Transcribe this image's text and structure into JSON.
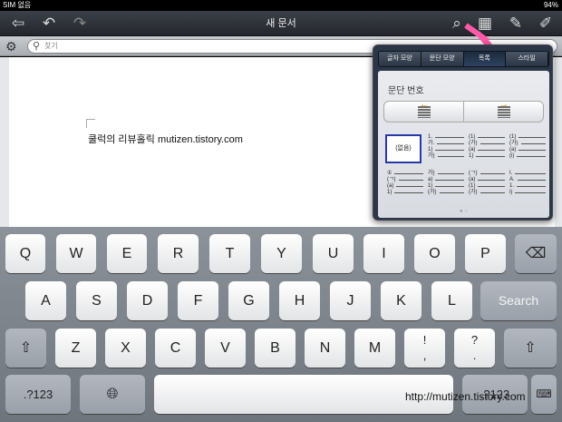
{
  "status": {
    "carrier": "SIM 없음",
    "battery": "94%"
  },
  "toolbar": {
    "title": "새 문서"
  },
  "search": {
    "placeholder": "찾기"
  },
  "document": {
    "text": "쿨럭의 리뷰홀릭 mutizen.tistory.com"
  },
  "popover": {
    "tabs": [
      {
        "label": "글자 모양",
        "active": false
      },
      {
        "label": "문단 모양",
        "active": false
      },
      {
        "label": "목록",
        "active": true
      },
      {
        "label": "스타일",
        "active": false
      }
    ],
    "heading": "문단 번호",
    "styles": [
      {
        "name": "none",
        "label": "(없음)"
      },
      {
        "name": "numbered-1",
        "lines": [
          "1.",
          "가.",
          "1)",
          "가)"
        ]
      },
      {
        "name": "numbered-2",
        "lines": [
          "(1)",
          "(가)",
          "(a)",
          "1)"
        ]
      },
      {
        "name": "numbered-3",
        "lines": [
          "(1)",
          "(가)",
          "(a)",
          "(i)"
        ]
      },
      {
        "name": "numbered-4",
        "lines": [
          "①",
          "(ㄱ)",
          "(a)",
          "1)"
        ]
      },
      {
        "name": "numbered-5",
        "lines": [
          "가)",
          "a)",
          "1)",
          "(가)"
        ]
      },
      {
        "name": "numbered-6",
        "lines": [
          "(ㄱ)",
          "(a)",
          "(1)",
          "(가)"
        ]
      },
      {
        "name": "numbered-7",
        "lines": [
          "I.",
          "A.",
          "1.",
          "i)"
        ]
      }
    ]
  },
  "keyboard": {
    "row1": [
      "Q",
      "W",
      "E",
      "R",
      "T",
      "Y",
      "U",
      "I",
      "O",
      "P"
    ],
    "row2": [
      "A",
      "S",
      "D",
      "F",
      "G",
      "H",
      "J",
      "K",
      "L"
    ],
    "row3": [
      "Z",
      "X",
      "C",
      "V",
      "B",
      "N",
      "M"
    ],
    "search_key": "Search",
    "mode_key": ".?123",
    "punct1": [
      "!",
      ","
    ],
    "punct2": [
      "?",
      "."
    ]
  },
  "watermark": "http://mutizen.tistory.com"
}
